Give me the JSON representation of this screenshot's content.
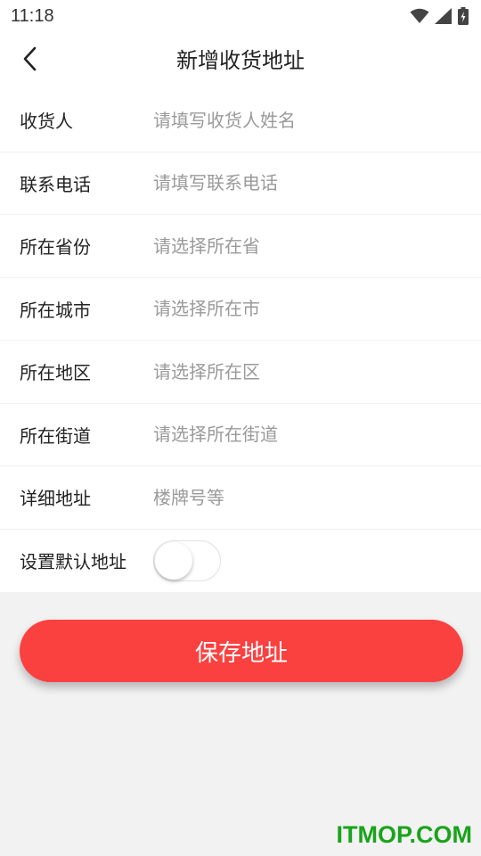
{
  "status_bar": {
    "time": "11:18",
    "icons": [
      "wifi-icon",
      "signal-icon",
      "battery-charging-icon"
    ]
  },
  "nav": {
    "back_icon": "chevron-left-icon",
    "title": "新增收货地址"
  },
  "form": {
    "rows": [
      {
        "label": "收货人",
        "placeholder": "请填写收货人姓名",
        "value": ""
      },
      {
        "label": "联系电话",
        "placeholder": "请填写联系电话",
        "value": ""
      },
      {
        "label": "所在省份",
        "placeholder": "请选择所在省",
        "value": ""
      },
      {
        "label": "所在城市",
        "placeholder": "请选择所在市",
        "value": ""
      },
      {
        "label": "所在地区",
        "placeholder": "请选择所在区",
        "value": ""
      },
      {
        "label": "所在街道",
        "placeholder": "请选择所在街道",
        "value": ""
      },
      {
        "label": "详细地址",
        "placeholder": "楼牌号等",
        "value": ""
      }
    ],
    "default_toggle": {
      "label": "设置默认地址",
      "on": false
    }
  },
  "save_button": {
    "label": "保存地址"
  },
  "watermark": "ITMOP.COM",
  "colors": {
    "accent": "#fb4040",
    "placeholder": "#9a9a9a",
    "background": "#f2f2f2",
    "watermark": "#1aa31a"
  }
}
